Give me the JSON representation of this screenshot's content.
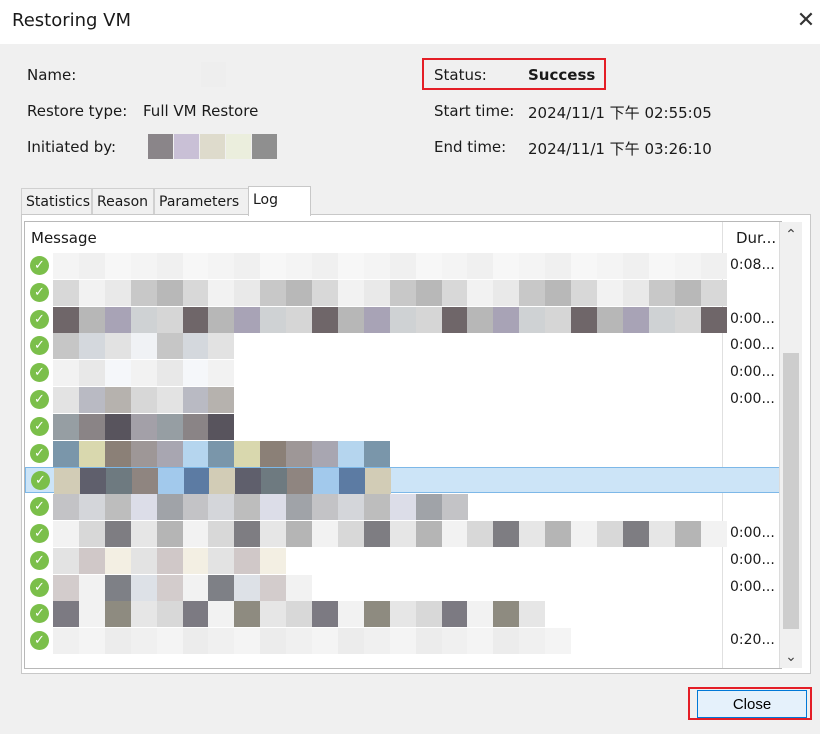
{
  "window": {
    "title": "Restoring VM"
  },
  "info": {
    "name_label": "Name:",
    "restore_type_label": "Restore type:",
    "restore_type_value": "Full VM Restore",
    "initiated_label": "Initiated by:",
    "status_label": "Status:",
    "status_value": "Success",
    "start_label": "Start time:",
    "start_value": "2024/11/1 下午 02:55:05",
    "end_label": "End time:",
    "end_value": "2024/11/1 下午 03:26:10"
  },
  "tabs": [
    "Statistics",
    "Reason",
    "Parameters",
    "Log"
  ],
  "log": {
    "columns": {
      "message": "Message",
      "duration": "Dur..."
    },
    "durations": [
      "0:08...",
      "",
      "0:00...",
      "0:00...",
      "0:00...",
      "0:00...",
      "",
      "",
      "",
      "",
      "0:00...",
      "0:00...",
      "0:00...",
      "",
      "0:20..."
    ]
  },
  "buttons": {
    "close_label": "Close"
  },
  "colors": {
    "status_highlight": "#e41e26",
    "success_icon": "#7bbf4a",
    "selection": "#cce4f7"
  },
  "icons": {
    "success": "check-circle-icon",
    "close": "close-icon"
  }
}
